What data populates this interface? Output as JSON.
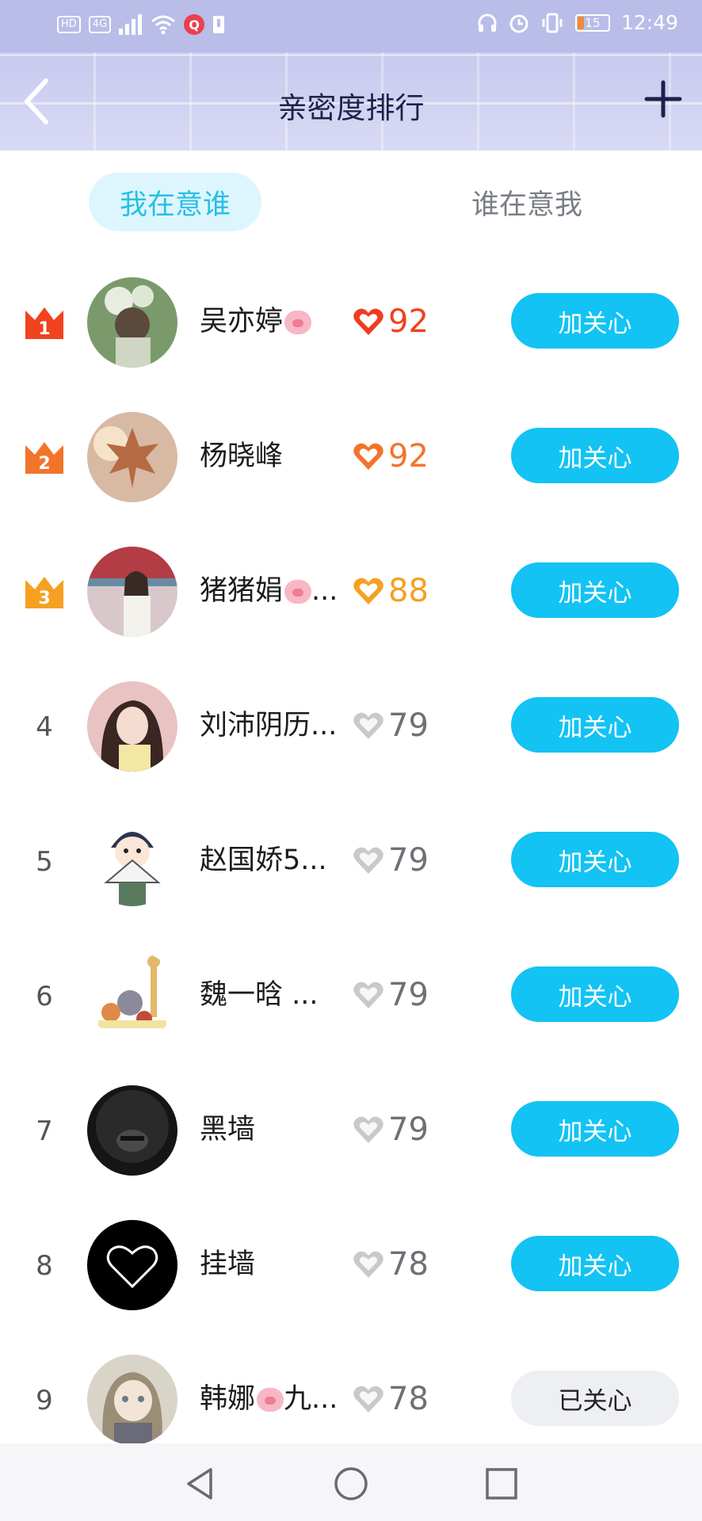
{
  "status_bar": {
    "left_icons": [
      "HD",
      "4G",
      "signal-icon",
      "wifi-icon",
      "Q",
      "notification-icon"
    ],
    "hd": "HD",
    "net": "4G",
    "q": "Q",
    "battery": "15",
    "time": "12:49"
  },
  "header": {
    "title": "亲密度排行"
  },
  "tabs": {
    "active": "我在意谁",
    "inactive": "谁在意我"
  },
  "list": [
    {
      "rank": "1",
      "name": "吴亦婷",
      "pig": true,
      "score": "92",
      "button": "加关心",
      "followed": false,
      "heart_color": "#f03b1f",
      "score_color": "#f0421f",
      "avatar": "flowers-girl"
    },
    {
      "rank": "2",
      "name": "杨晓峰",
      "pig": false,
      "score": "92",
      "button": "加关心",
      "followed": false,
      "heart_color": "#f2742a",
      "score_color": "#f2742a",
      "avatar": "maple-leaf"
    },
    {
      "rank": "3",
      "name": "猪猪娟",
      "pig": true,
      "ellipsis": "...",
      "score": "88",
      "button": "加关心",
      "followed": false,
      "heart_color": "#f5a021",
      "score_color": "#f5a021",
      "avatar": "girl-shop"
    },
    {
      "rank": "4",
      "name": "刘沛阴历...",
      "pig": false,
      "score": "79",
      "button": "加关心",
      "followed": false,
      "heart_color": "#c9c9cc",
      "score_color": "#6f6f75",
      "avatar": "girl-pink"
    },
    {
      "rank": "5",
      "name": "赵国娇5...",
      "pig": false,
      "score": "79",
      "button": "加关心",
      "followed": false,
      "heart_color": "#c9c9cc",
      "score_color": "#6f6f75",
      "avatar": "cartoon-fan"
    },
    {
      "rank": "6",
      "name": "魏一晗 ...",
      "pig": false,
      "score": "79",
      "button": "加关心",
      "followed": false,
      "heart_color": "#c9c9cc",
      "score_color": "#6f6f75",
      "avatar": "toys"
    },
    {
      "rank": "7",
      "name": "黑墙",
      "pig": false,
      "score": "79",
      "button": "加关心",
      "followed": false,
      "heart_color": "#c9c9cc",
      "score_color": "#6f6f75",
      "avatar": "black-afro"
    },
    {
      "rank": "8",
      "name": "挂墙",
      "pig": false,
      "score": "78",
      "button": "加关心",
      "followed": false,
      "heart_color": "#c9c9cc",
      "score_color": "#6f6f75",
      "avatar": "black-heart"
    },
    {
      "rank": "9",
      "name": "韩娜",
      "pig": true,
      "ellipsis": "九...",
      "score": "78",
      "button": "已关心",
      "followed": true,
      "heart_color": "#c9c9cc",
      "score_color": "#6f6f75",
      "avatar": "anime-girl"
    }
  ],
  "crown_colors": {
    "1": "#f0421f",
    "2": "#f2742a",
    "3": "#f5a021"
  },
  "colors": {
    "accent": "#12c3f3",
    "tab_active_bg": "#ddf6fd",
    "tab_active_text": "#27bfe5"
  }
}
